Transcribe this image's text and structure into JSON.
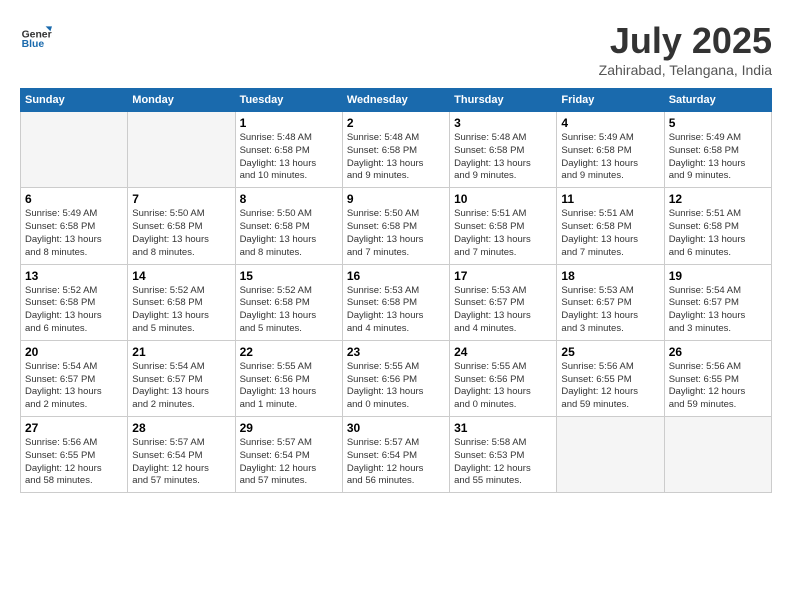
{
  "header": {
    "logo_line1": "General",
    "logo_line2": "Blue",
    "month": "July 2025",
    "location": "Zahirabad, Telangana, India"
  },
  "weekdays": [
    "Sunday",
    "Monday",
    "Tuesday",
    "Wednesday",
    "Thursday",
    "Friday",
    "Saturday"
  ],
  "weeks": [
    [
      {
        "day": "",
        "detail": ""
      },
      {
        "day": "",
        "detail": ""
      },
      {
        "day": "1",
        "detail": "Sunrise: 5:48 AM\nSunset: 6:58 PM\nDaylight: 13 hours\nand 10 minutes."
      },
      {
        "day": "2",
        "detail": "Sunrise: 5:48 AM\nSunset: 6:58 PM\nDaylight: 13 hours\nand 9 minutes."
      },
      {
        "day": "3",
        "detail": "Sunrise: 5:48 AM\nSunset: 6:58 PM\nDaylight: 13 hours\nand 9 minutes."
      },
      {
        "day": "4",
        "detail": "Sunrise: 5:49 AM\nSunset: 6:58 PM\nDaylight: 13 hours\nand 9 minutes."
      },
      {
        "day": "5",
        "detail": "Sunrise: 5:49 AM\nSunset: 6:58 PM\nDaylight: 13 hours\nand 9 minutes."
      }
    ],
    [
      {
        "day": "6",
        "detail": "Sunrise: 5:49 AM\nSunset: 6:58 PM\nDaylight: 13 hours\nand 8 minutes."
      },
      {
        "day": "7",
        "detail": "Sunrise: 5:50 AM\nSunset: 6:58 PM\nDaylight: 13 hours\nand 8 minutes."
      },
      {
        "day": "8",
        "detail": "Sunrise: 5:50 AM\nSunset: 6:58 PM\nDaylight: 13 hours\nand 8 minutes."
      },
      {
        "day": "9",
        "detail": "Sunrise: 5:50 AM\nSunset: 6:58 PM\nDaylight: 13 hours\nand 7 minutes."
      },
      {
        "day": "10",
        "detail": "Sunrise: 5:51 AM\nSunset: 6:58 PM\nDaylight: 13 hours\nand 7 minutes."
      },
      {
        "day": "11",
        "detail": "Sunrise: 5:51 AM\nSunset: 6:58 PM\nDaylight: 13 hours\nand 7 minutes."
      },
      {
        "day": "12",
        "detail": "Sunrise: 5:51 AM\nSunset: 6:58 PM\nDaylight: 13 hours\nand 6 minutes."
      }
    ],
    [
      {
        "day": "13",
        "detail": "Sunrise: 5:52 AM\nSunset: 6:58 PM\nDaylight: 13 hours\nand 6 minutes."
      },
      {
        "day": "14",
        "detail": "Sunrise: 5:52 AM\nSunset: 6:58 PM\nDaylight: 13 hours\nand 5 minutes."
      },
      {
        "day": "15",
        "detail": "Sunrise: 5:52 AM\nSunset: 6:58 PM\nDaylight: 13 hours\nand 5 minutes."
      },
      {
        "day": "16",
        "detail": "Sunrise: 5:53 AM\nSunset: 6:58 PM\nDaylight: 13 hours\nand 4 minutes."
      },
      {
        "day": "17",
        "detail": "Sunrise: 5:53 AM\nSunset: 6:57 PM\nDaylight: 13 hours\nand 4 minutes."
      },
      {
        "day": "18",
        "detail": "Sunrise: 5:53 AM\nSunset: 6:57 PM\nDaylight: 13 hours\nand 3 minutes."
      },
      {
        "day": "19",
        "detail": "Sunrise: 5:54 AM\nSunset: 6:57 PM\nDaylight: 13 hours\nand 3 minutes."
      }
    ],
    [
      {
        "day": "20",
        "detail": "Sunrise: 5:54 AM\nSunset: 6:57 PM\nDaylight: 13 hours\nand 2 minutes."
      },
      {
        "day": "21",
        "detail": "Sunrise: 5:54 AM\nSunset: 6:57 PM\nDaylight: 13 hours\nand 2 minutes."
      },
      {
        "day": "22",
        "detail": "Sunrise: 5:55 AM\nSunset: 6:56 PM\nDaylight: 13 hours\nand 1 minute."
      },
      {
        "day": "23",
        "detail": "Sunrise: 5:55 AM\nSunset: 6:56 PM\nDaylight: 13 hours\nand 0 minutes."
      },
      {
        "day": "24",
        "detail": "Sunrise: 5:55 AM\nSunset: 6:56 PM\nDaylight: 13 hours\nand 0 minutes."
      },
      {
        "day": "25",
        "detail": "Sunrise: 5:56 AM\nSunset: 6:55 PM\nDaylight: 12 hours\nand 59 minutes."
      },
      {
        "day": "26",
        "detail": "Sunrise: 5:56 AM\nSunset: 6:55 PM\nDaylight: 12 hours\nand 59 minutes."
      }
    ],
    [
      {
        "day": "27",
        "detail": "Sunrise: 5:56 AM\nSunset: 6:55 PM\nDaylight: 12 hours\nand 58 minutes."
      },
      {
        "day": "28",
        "detail": "Sunrise: 5:57 AM\nSunset: 6:54 PM\nDaylight: 12 hours\nand 57 minutes."
      },
      {
        "day": "29",
        "detail": "Sunrise: 5:57 AM\nSunset: 6:54 PM\nDaylight: 12 hours\nand 57 minutes."
      },
      {
        "day": "30",
        "detail": "Sunrise: 5:57 AM\nSunset: 6:54 PM\nDaylight: 12 hours\nand 56 minutes."
      },
      {
        "day": "31",
        "detail": "Sunrise: 5:58 AM\nSunset: 6:53 PM\nDaylight: 12 hours\nand 55 minutes."
      },
      {
        "day": "",
        "detail": ""
      },
      {
        "day": "",
        "detail": ""
      }
    ]
  ]
}
